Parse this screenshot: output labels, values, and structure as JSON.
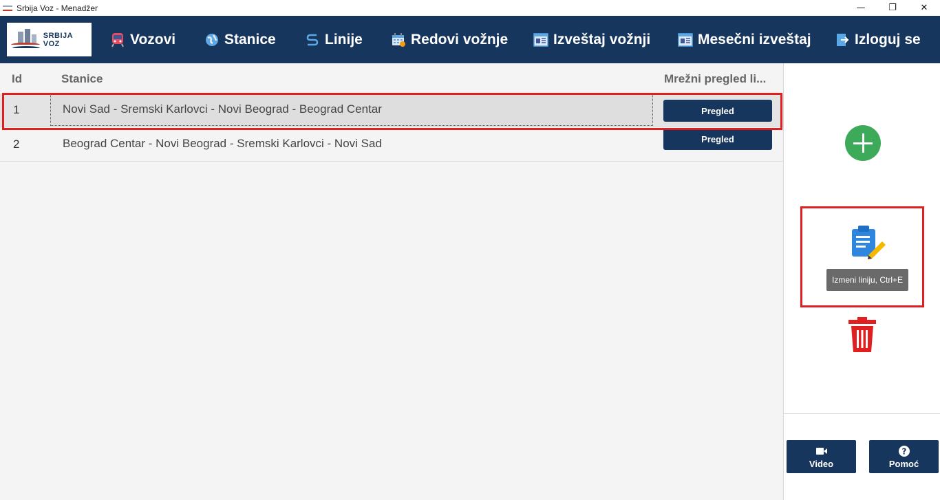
{
  "window": {
    "title": "Srbija Voz - Menadžer",
    "controls": {
      "minimize": "—",
      "maximize": "❐",
      "close": "✕"
    }
  },
  "logo": {
    "text": "SRBIJA VOZ"
  },
  "nav": {
    "items": [
      {
        "label": "Vozovi",
        "icon": "train-icon"
      },
      {
        "label": "Stanice",
        "icon": "globe-icon"
      },
      {
        "label": "Linije",
        "icon": "route-icon"
      },
      {
        "label": "Redovi vožnje",
        "icon": "calendar-icon"
      },
      {
        "label": "Izveštaj vožnji",
        "icon": "report-icon"
      },
      {
        "label": "Mesečni izveštaj",
        "icon": "report-icon"
      },
      {
        "label": "Izloguj se",
        "icon": "logout-icon"
      }
    ]
  },
  "table": {
    "columns": [
      "Id",
      "Stanice",
      "Mrežni pregled li..."
    ],
    "rows": [
      {
        "id": "1",
        "stanice": "Novi Sad - Sremski Karlovci - Novi Beograd - Beograd Centar",
        "button": "Pregled",
        "selected": true
      },
      {
        "id": "2",
        "stanice": "Beograd Centar - Novi Beograd - Sremski Karlovci - Novi Sad",
        "button": "Pregled",
        "selected": false
      }
    ]
  },
  "sidebar": {
    "tooltip": "Izmeni liniju, Ctrl+E",
    "video_label": "Video",
    "help_label": "Pomoć"
  },
  "colors": {
    "navy": "#17365d",
    "green": "#3daa5a",
    "red": "#e02020",
    "edit_blue": "#2e86de",
    "pencil_yellow": "#f5b800"
  }
}
